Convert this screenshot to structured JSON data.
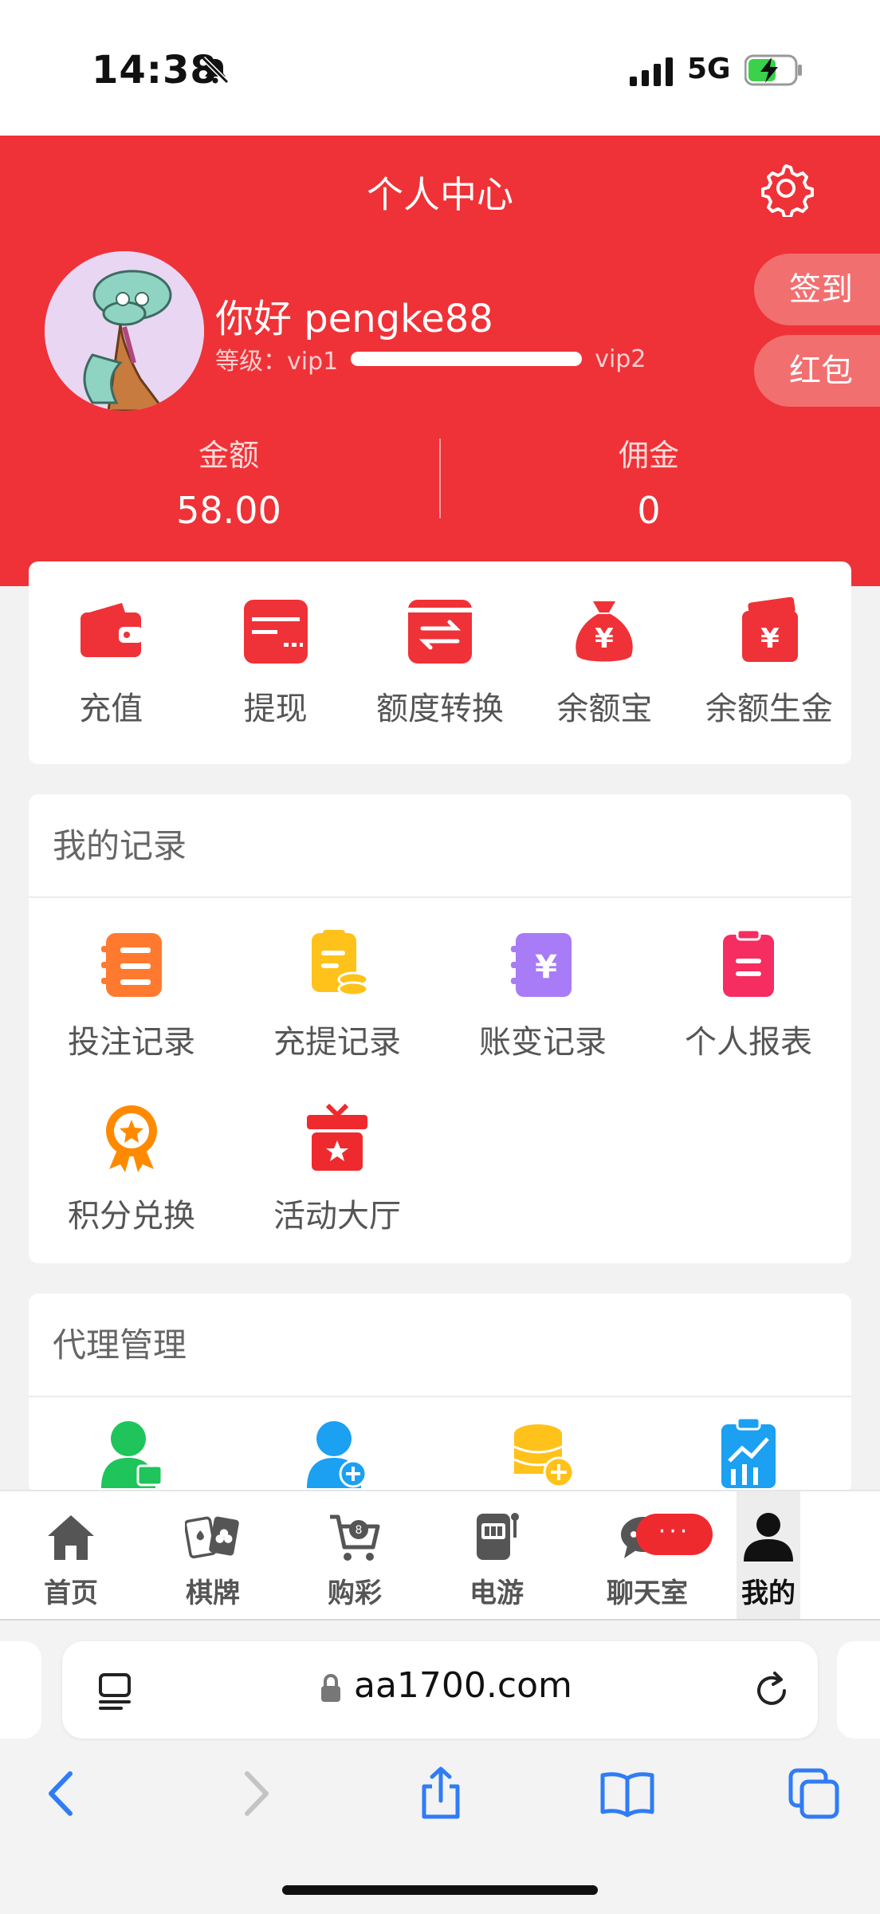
{
  "status_bar": {
    "time": "14:38",
    "network": "5G"
  },
  "header": {
    "title": "个人中心",
    "greeting": "你好 pengke88",
    "level_label": "等级：vip1",
    "next_level": "vip2",
    "signin_label": "签到",
    "redpack_label": "红包",
    "balance_label": "金额",
    "balance_value": "58.00",
    "commission_label": "佣金",
    "commission_value": "0"
  },
  "quick_actions": [
    {
      "label": "充值",
      "icon": "wallet-icon"
    },
    {
      "label": "提现",
      "icon": "card-icon"
    },
    {
      "label": "额度转换",
      "icon": "transfer-icon"
    },
    {
      "label": "余额宝",
      "icon": "money-bag-icon"
    },
    {
      "label": "余额生金",
      "icon": "cash-stack-icon"
    }
  ],
  "records": {
    "title": "我的记录",
    "items": [
      {
        "label": "投注记录",
        "icon": "betting-record-icon"
      },
      {
        "label": "充提记录",
        "icon": "deposit-withdraw-icon"
      },
      {
        "label": "账变记录",
        "icon": "account-change-icon"
      },
      {
        "label": "个人报表",
        "icon": "report-icon"
      },
      {
        "label": "积分兑换",
        "icon": "medal-icon"
      },
      {
        "label": "活动大厅",
        "icon": "gift-icon"
      }
    ]
  },
  "agent": {
    "title": "代理管理"
  },
  "tabbar": {
    "items": [
      {
        "label": "首页",
        "icon": "home-icon"
      },
      {
        "label": "棋牌",
        "icon": "cards-icon"
      },
      {
        "label": "购彩",
        "icon": "lottery-cart-icon"
      },
      {
        "label": "电游",
        "icon": "slot-machine-icon"
      },
      {
        "label": "聊天室",
        "icon": "chat-icon"
      },
      {
        "label": "我的",
        "icon": "user-icon"
      }
    ],
    "chat_badge": "···"
  },
  "browser": {
    "url": "aa1700.com"
  },
  "colors": {
    "brand_red": "#ef3237",
    "orange": "#ff7a2f",
    "yellow": "#ffc21a",
    "purple": "#a77cf6",
    "pink": "#f52d60"
  }
}
